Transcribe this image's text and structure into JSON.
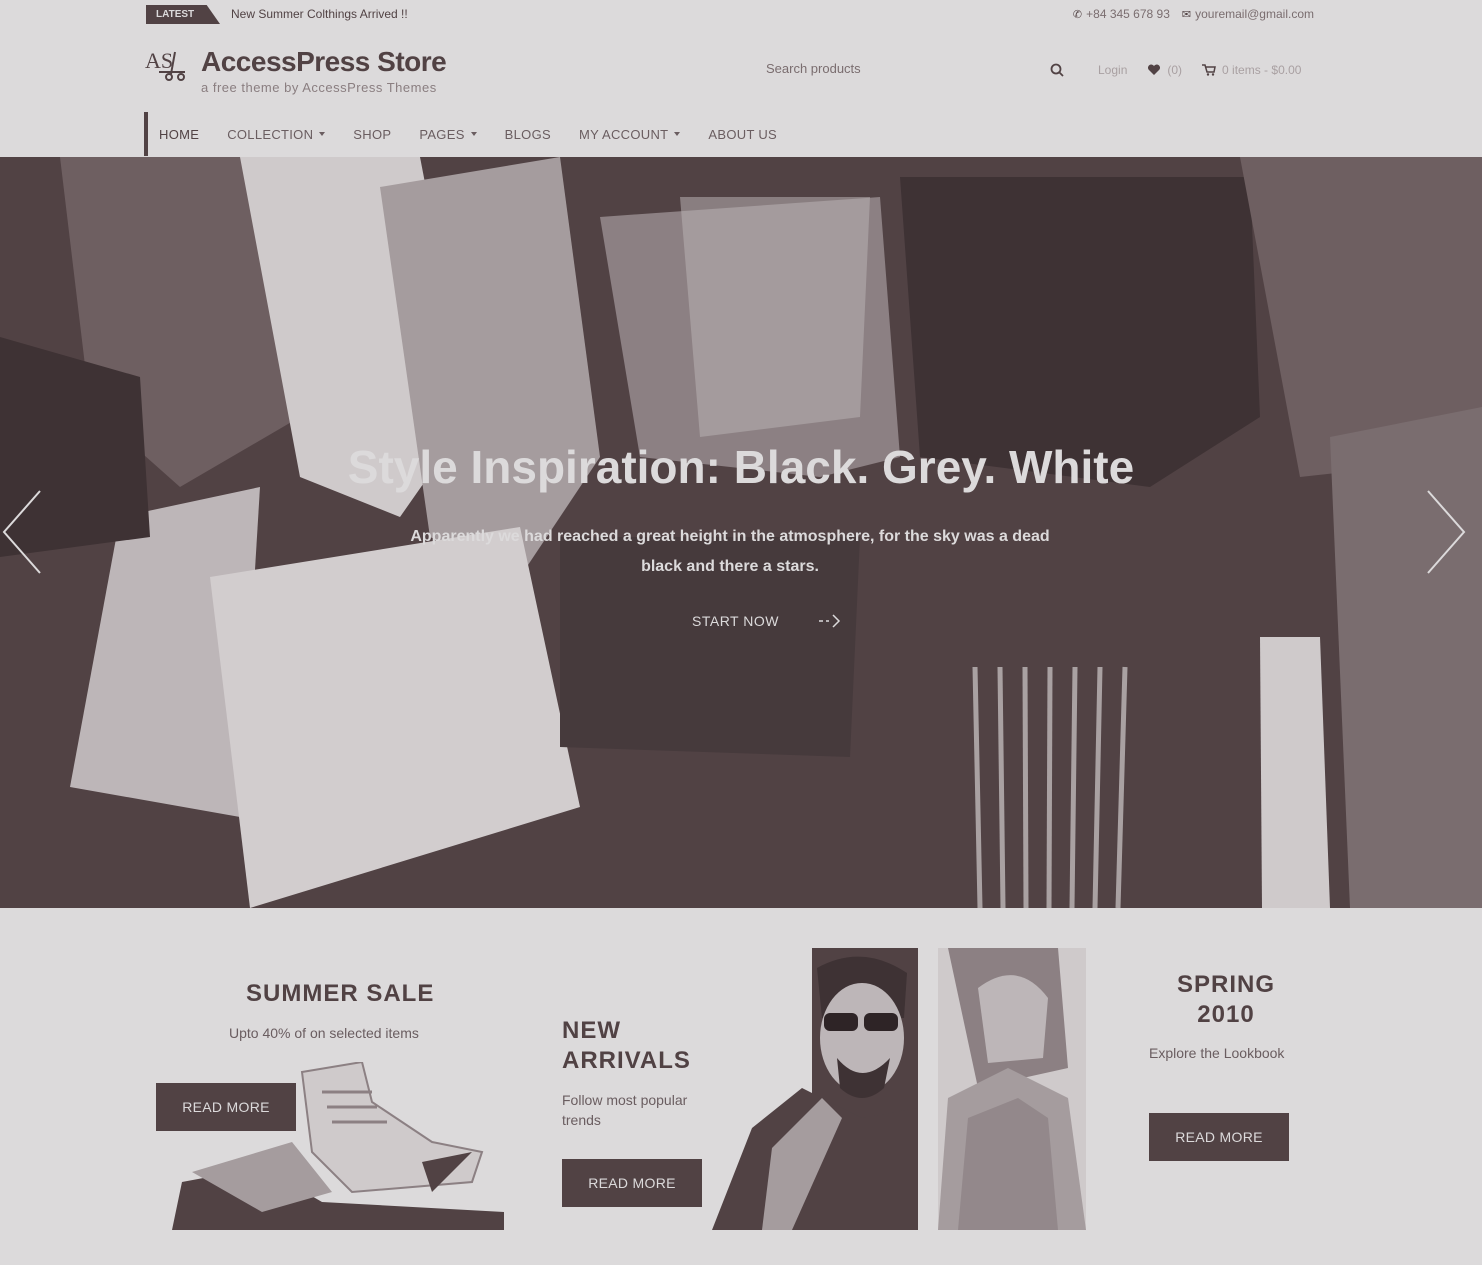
{
  "topbar": {
    "latest_label": "LATEST",
    "latest_text": "New Summer Colthings Arrived !!",
    "phone": "+84 345 678 93",
    "email": "youremail@gmail.com"
  },
  "header": {
    "logo_text": "AS",
    "site_title": "AccessPress Store",
    "tagline": "a free theme by AccessPress Themes",
    "search_placeholder": "Search products",
    "login_label": "Login",
    "wishlist_count": "(0)",
    "cart_label": "0 items - $0.00"
  },
  "nav": {
    "items": [
      {
        "label": "HOME"
      },
      {
        "label": "COLLECTION"
      },
      {
        "label": "SHOP"
      },
      {
        "label": "PAGES"
      },
      {
        "label": "BLOGS"
      },
      {
        "label": "MY ACCOUNT"
      },
      {
        "label": "ABOUT US"
      }
    ]
  },
  "hero": {
    "title": "Style Inspiration: Black. Grey. White",
    "description": "Apparently we had reached a great height in the atmosphere, for the sky was a dead black and there a stars.",
    "cta_label": "START NOW"
  },
  "promos": {
    "summer": {
      "title": "SUMMER SALE",
      "subtitle": "Upto 40% of on selected items",
      "button": "READ MORE"
    },
    "arrivals": {
      "title": "NEW ARRIVALS",
      "subtitle": "Follow most popular trends",
      "button": "READ MORE"
    },
    "spring": {
      "title": "SPRING 2010",
      "subtitle": "Explore the Lookbook",
      "button": "READ MORE"
    }
  },
  "colors": {
    "primary": "#514244",
    "background": "#dcdadb"
  }
}
